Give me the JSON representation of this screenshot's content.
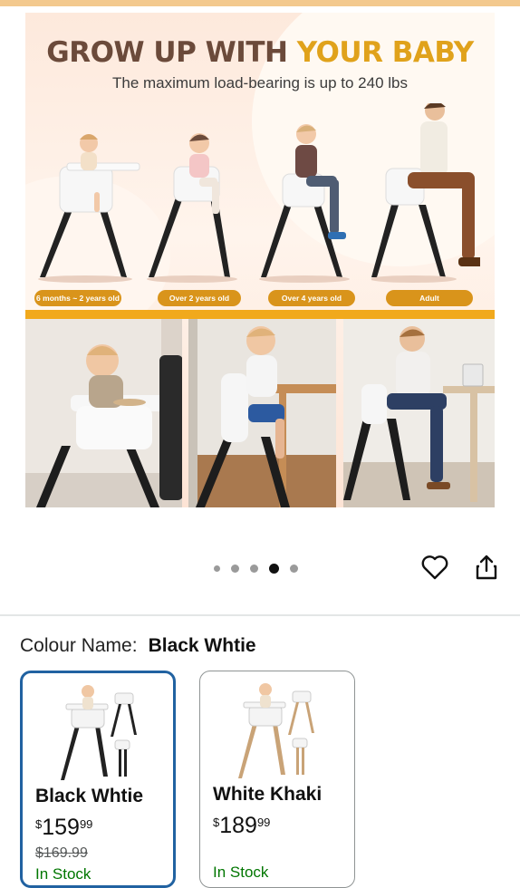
{
  "hero": {
    "title_part1": "GROW UP WITH ",
    "title_part2": "YOUR BABY",
    "subtitle": "The maximum load-bearing is up to 240 lbs",
    "stages": [
      {
        "label": "6 months ~ 2 years old"
      },
      {
        "label": "Over 2 years old"
      },
      {
        "label": "Over 4 years old"
      },
      {
        "label": "Adult"
      }
    ],
    "colors": {
      "title_brown": "#6b4a3a",
      "title_gold": "#e0a21b",
      "pill": "#d9941b"
    }
  },
  "carousel": {
    "total_dots": 5,
    "active_index": 3
  },
  "actions": {
    "favorite_icon": "heart-icon",
    "share_icon": "share-icon"
  },
  "colour": {
    "label": "Colour Name:",
    "selected": "Black Whtie",
    "options": [
      {
        "name": "Black Whtie",
        "price_symbol": "$",
        "price_whole": "159",
        "price_fraction": "99",
        "list_price": "$169.99",
        "stock": "In Stock",
        "selected": true
      },
      {
        "name": "White Khaki",
        "price_symbol": "$",
        "price_whole": "189",
        "price_fraction": "99",
        "stock": "In Stock",
        "selected": false
      }
    ],
    "accent": "#2162a1"
  }
}
